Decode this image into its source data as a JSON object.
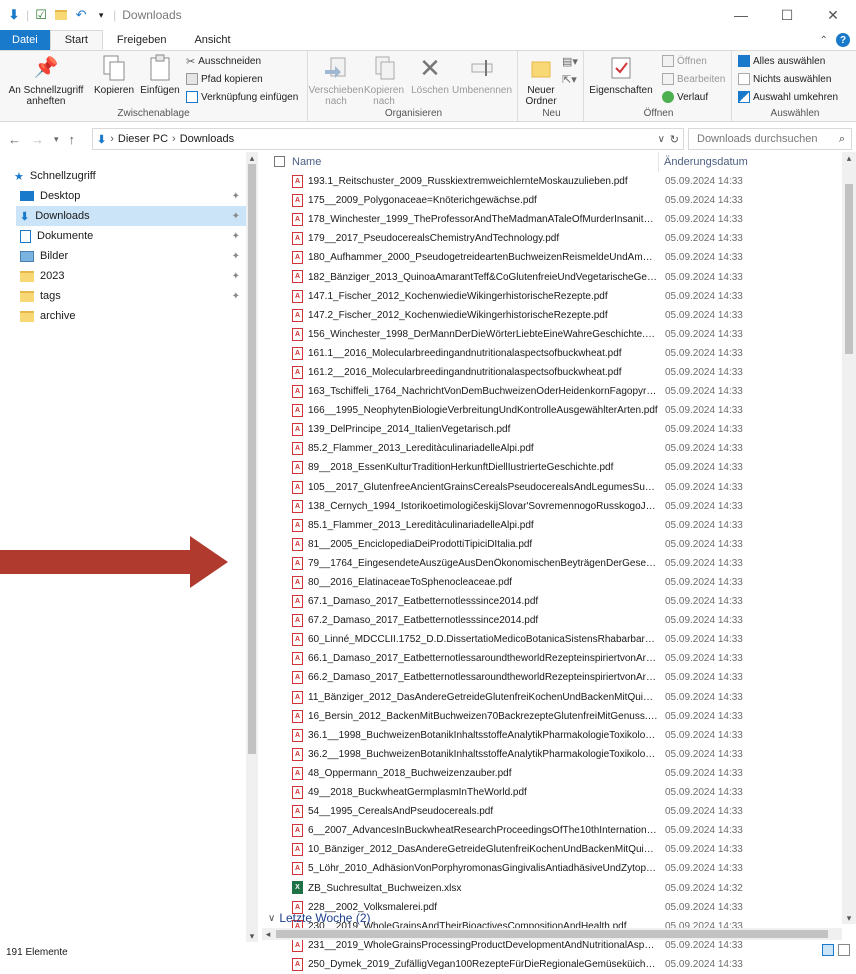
{
  "window": {
    "title": "Downloads"
  },
  "ribbon_tabs": [
    "Datei",
    "Start",
    "Freigeben",
    "Ansicht"
  ],
  "clipboard": {
    "pin_label": "An Schnellzugriff anheften",
    "copy_label": "Kopieren",
    "paste_label": "Einfügen",
    "cut_label": "Ausschneiden",
    "copy_path_label": "Pfad kopieren",
    "paste_shortcut_label": "Verknüpfung einfügen",
    "group_label": "Zwischenablage"
  },
  "organize": {
    "move_label": "Verschieben nach",
    "copyto_label": "Kopieren nach",
    "delete_label": "Löschen",
    "rename_label": "Umbenennen",
    "group_label": "Organisieren"
  },
  "new": {
    "folder_label": "Neuer Ordner",
    "group_label": "Neu"
  },
  "open": {
    "properties_label": "Eigenschaften",
    "open_label": "Öffnen",
    "edit_label": "Bearbeiten",
    "history_label": "Verlauf",
    "group_label": "Öffnen"
  },
  "select": {
    "all_label": "Alles auswählen",
    "none_label": "Nichts auswählen",
    "invert_label": "Auswahl umkehren",
    "group_label": "Auswählen"
  },
  "address": {
    "root": "Dieser PC",
    "current": "Downloads",
    "search_placeholder": "Downloads durchsuchen"
  },
  "nav": {
    "quick_access": "Schnellzugriff",
    "items": [
      "Desktop",
      "Downloads",
      "Dokumente",
      "Bilder",
      "2023",
      "tags",
      "archive"
    ]
  },
  "columns": {
    "name": "Name",
    "date": "Änderungsdatum"
  },
  "files": [
    {
      "name": "193.1_Reitschuster_2009_RusskiextremweichlernteMoskauzulieben.pdf",
      "date": "05.09.2024 14:33",
      "type": "pdf"
    },
    {
      "name": "175__2009_Polygonaceae=Knöterichgewächse.pdf",
      "date": "05.09.2024 14:33",
      "type": "pdf"
    },
    {
      "name": "178_Winchester_1999_TheProfessorAndTheMadmanATaleOfMurderInsanityAn...",
      "date": "05.09.2024 14:33",
      "type": "pdf"
    },
    {
      "name": "179__2017_PseudocerealsChemistryAndTechnology.pdf",
      "date": "05.09.2024 14:33",
      "type": "pdf"
    },
    {
      "name": "180_Aufhammer_2000_PseudogetreideartenBuchweizenReismeldeUndAmara...",
      "date": "05.09.2024 14:33",
      "type": "pdf"
    },
    {
      "name": "182_Bänziger_2013_QuinoaAmarantTeff&CoGlutenfreieUndVegetarischeGenus...",
      "date": "05.09.2024 14:33",
      "type": "pdf"
    },
    {
      "name": "147.1_Fischer_2012_KochenwiedieWikingerhistorischeRezepte.pdf",
      "date": "05.09.2024 14:33",
      "type": "pdf"
    },
    {
      "name": "147.2_Fischer_2012_KochenwiedieWikingerhistorischeRezepte.pdf",
      "date": "05.09.2024 14:33",
      "type": "pdf"
    },
    {
      "name": "156_Winchester_1998_DerMannDerDieWörterLiebteEineWahreGeschichte.pdf",
      "date": "05.09.2024 14:33",
      "type": "pdf"
    },
    {
      "name": "161.1__2016_Molecularbreedingandnutritionalaspectsofbuckwheat.pdf",
      "date": "05.09.2024 14:33",
      "type": "pdf"
    },
    {
      "name": "161.2__2016_Molecularbreedingandnutritionalaspectsofbuckwheat.pdf",
      "date": "05.09.2024 14:33",
      "type": "pdf"
    },
    {
      "name": "163_Tschiffeli_1764_NachrichtVonDemBuchweizenOderHeidenkornFagopyru...",
      "date": "05.09.2024 14:33",
      "type": "pdf"
    },
    {
      "name": "166__1995_NeophytenBiologieVerbreitungUndKontrolleAusgewählterArten.pdf",
      "date": "05.09.2024 14:33",
      "type": "pdf"
    },
    {
      "name": "139_DelPrincipe_2014_ItalienVegetarisch.pdf",
      "date": "05.09.2024 14:33",
      "type": "pdf"
    },
    {
      "name": "85.2_Flammer_2013_LereditàculinariadelleAlpi.pdf",
      "date": "05.09.2024 14:33",
      "type": "pdf"
    },
    {
      "name": "89__2018_EssenKulturTraditionHerkunftDiellIustrierteGeschichte.pdf",
      "date": "05.09.2024 14:33",
      "type": "pdf"
    },
    {
      "name": "105__2017_GlutenfreeAncientGrainsCerealsPseudocerealsAndLegumesSustain...",
      "date": "05.09.2024 14:33",
      "type": "pdf"
    },
    {
      "name": "138_Černych_1994_IstorikoetimologičeskijSlovar'SovremennogoRusskogoJazy...",
      "date": "05.09.2024 14:33",
      "type": "pdf"
    },
    {
      "name": "85.1_Flammer_2013_LereditàculinariadelleAlpi.pdf",
      "date": "05.09.2024 14:33",
      "type": "pdf"
    },
    {
      "name": "81__2005_EnciclopediaDeiProdottiTipiciDItalia.pdf",
      "date": "05.09.2024 14:33",
      "type": "pdf"
    },
    {
      "name": "79__1764_EingesendeteAuszügeAusDenÖkonomischenBeyträgenDerGesellsch...",
      "date": "05.09.2024 14:33",
      "type": "pdf"
    },
    {
      "name": "80__2016_ElatinaceaeToSphenocleaceae.pdf",
      "date": "05.09.2024 14:33",
      "type": "pdf"
    },
    {
      "name": "67.1_Damaso_2017_Eatbetternotlesssince2014.pdf",
      "date": "05.09.2024 14:33",
      "type": "pdf"
    },
    {
      "name": "67.2_Damaso_2017_Eatbetternotlesssince2014.pdf",
      "date": "05.09.2024 14:33",
      "type": "pdf"
    },
    {
      "name": "60_Linné_MDCCLII.1752_D.D.DissertatioMedicoBotanicaSistensRhabarbarumQ...",
      "date": "05.09.2024 14:33",
      "type": "pdf"
    },
    {
      "name": "66.1_Damaso_2017_EatbetternotlessaroundtheworldRezepteinspiriertvonArom...",
      "date": "05.09.2024 14:33",
      "type": "pdf"
    },
    {
      "name": "66.2_Damaso_2017_EatbetternotlessaroundtheworldRezepteinspiriertvonArom...",
      "date": "05.09.2024 14:33",
      "type": "pdf"
    },
    {
      "name": "11_Bänziger_2012_DasAndereGetreideGlutenfreiKochenUndBackenMitQuinoa...",
      "date": "05.09.2024 14:33",
      "type": "pdf"
    },
    {
      "name": "16_Bersin_2012_BackenMitBuchweizen70BackrezepteGlutenfreiMitGenuss.pdf",
      "date": "05.09.2024 14:33",
      "type": "pdf"
    },
    {
      "name": "36.1__1998_BuchweizenBotanikInhaltsstoffeAnalytikPharmakologieToxikologi...",
      "date": "05.09.2024 14:33",
      "type": "pdf"
    },
    {
      "name": "36.2__1998_BuchweizenBotanikInhaltsstoffeAnalytikPharmakologieToxikologi...",
      "date": "05.09.2024 14:33",
      "type": "pdf"
    },
    {
      "name": "48_Oppermann_2018_Buchweizenzauber.pdf",
      "date": "05.09.2024 14:33",
      "type": "pdf"
    },
    {
      "name": "49__2018_BuckwheatGermplasmInTheWorld.pdf",
      "date": "05.09.2024 14:33",
      "type": "pdf"
    },
    {
      "name": "54__1995_CerealsAndPseudocereals.pdf",
      "date": "05.09.2024 14:33",
      "type": "pdf"
    },
    {
      "name": "6__2007_AdvancesInBuckwheatResearchProceedingsOfThe10thInternationalSy...",
      "date": "05.09.2024 14:33",
      "type": "pdf"
    },
    {
      "name": "10_Bänziger_2012_DasAndereGetreideGlutenfreiKochenUndBackenMitQuinoa...",
      "date": "05.09.2024 14:33",
      "type": "pdf"
    },
    {
      "name": "5_Löhr_2010_AdhäsionVonPorphyromonasGingivalisAntiadhäsiveUndZytopro...",
      "date": "05.09.2024 14:33",
      "type": "pdf"
    },
    {
      "name": "ZB_Suchresultat_Buchweizen.xlsx",
      "date": "05.09.2024 14:32",
      "type": "xlsx"
    },
    {
      "name": "228__2002_Volksmalerei.pdf",
      "date": "05.09.2024 14:33",
      "type": "pdf"
    },
    {
      "name": "230__2019_WholeGrainsAndTheirBioactivesCompositionAndHealth.pdf",
      "date": "05.09.2024 14:33",
      "type": "pdf"
    },
    {
      "name": "231__2019_WholeGrainsProcessingProductDevelopmentAndNutritionalAspect...",
      "date": "05.09.2024 14:33",
      "type": "pdf"
    },
    {
      "name": "250_Dymek_2019_ZufälligVegan100RezepteFürDieRegionaleGemüseküicheNic...",
      "date": "05.09.2024 14:33",
      "type": "pdf"
    }
  ],
  "group_header": "Letzte Woche (2)",
  "status": {
    "count": "191 Elemente"
  }
}
